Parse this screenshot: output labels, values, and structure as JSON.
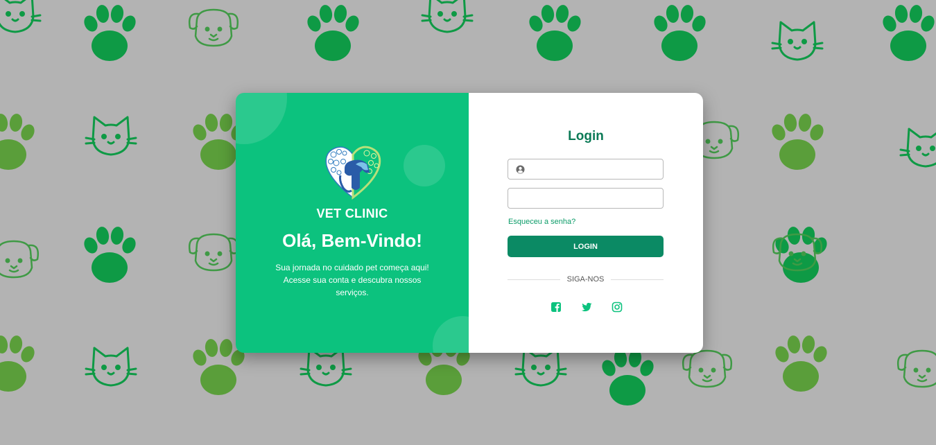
{
  "brand": {
    "name": "VET CLINIC",
    "welcome": "Olá, Bem-Vindo!",
    "tagline": "Sua jornada no cuidado pet começa aqui! Acesse sua conta e descubra nossos serviços."
  },
  "login": {
    "title": "Login",
    "username_value": "",
    "password_value": "",
    "forgot_link": "Esqueceu a senha?",
    "button_label": "LOGIN"
  },
  "social": {
    "label": "SIGA-NOS",
    "icons": [
      "facebook-icon",
      "twitter-icon",
      "instagram-icon"
    ]
  },
  "colors": {
    "background": "#b3b3b3",
    "panel_green": "#0cc27e",
    "button_green": "#0b8a64",
    "title_green": "#0b7a56",
    "link_green": "#0b9c68",
    "pattern_dark": "#0e9a45",
    "pattern_light": "#5a9e3a"
  }
}
